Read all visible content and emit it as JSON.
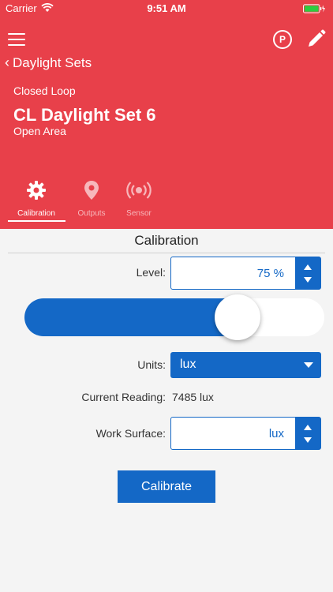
{
  "status_bar": {
    "carrier": "Carrier",
    "time": "9:51 AM"
  },
  "header": {
    "back_label": "Daylight Sets",
    "subtitle": "Closed Loop",
    "title": "CL Daylight Set 6",
    "area": "Open Area",
    "colors": {
      "background": "#e8404a"
    },
    "icons": [
      "menu-icon",
      "parking-icon",
      "pencil-icon"
    ],
    "parking_letter": "P"
  },
  "tabs": [
    {
      "label": "Calibration",
      "icon": "gear-icon",
      "active": true
    },
    {
      "label": "Outputs",
      "icon": "location-pin-icon",
      "active": false
    },
    {
      "label": "Sensor",
      "icon": "broadcast-icon",
      "active": false
    }
  ],
  "calibration": {
    "section_title": "Calibration",
    "level_label": "Level:",
    "level_value": "75 %",
    "slider_level_percent": 75,
    "units_label": "Units:",
    "units_value": "lux",
    "reading_label": "Current Reading:",
    "reading_value": "7485 lux",
    "work_surface_label": "Work Surface:",
    "work_surface_value": "lux",
    "calibrate_button": "Calibrate",
    "accent_color": "#1468c6"
  }
}
